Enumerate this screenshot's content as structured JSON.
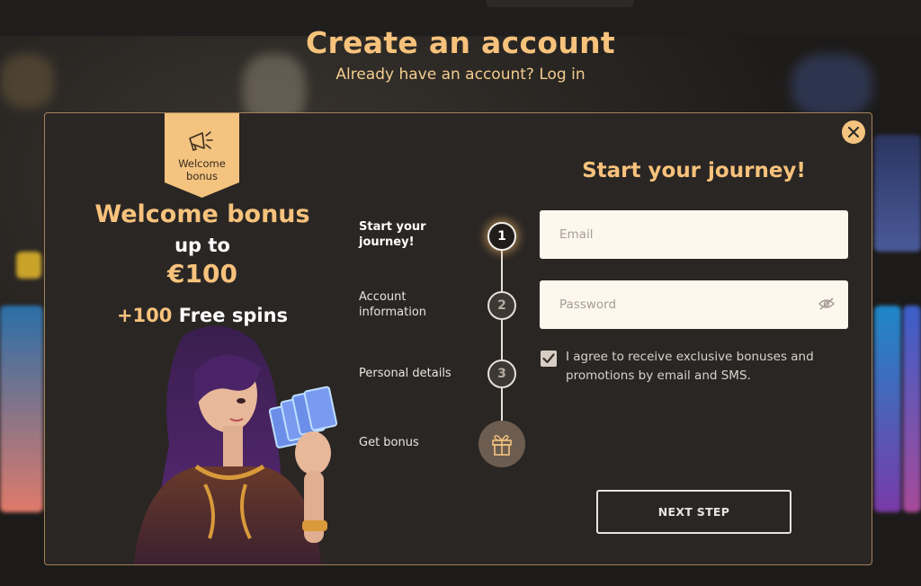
{
  "page": {
    "title": "Create an account",
    "login_prompt": "Already have an account?",
    "login_link": "Log in"
  },
  "promo": {
    "badge": "Welcome bonus",
    "badge_icon": "megaphone-icon",
    "title": "Welcome bonus",
    "upto": "up to",
    "amount": "€100",
    "spins_amount": "+100",
    "spins_label": "Free spins"
  },
  "steps": [
    {
      "label": "Start your journey!",
      "number": "1",
      "state": "active"
    },
    {
      "label": "Account information",
      "number": "2",
      "state": "inactive"
    },
    {
      "label": "Personal details",
      "number": "3",
      "state": "inactive"
    },
    {
      "label": "Get bonus",
      "icon": "gift-icon",
      "state": "inactive"
    }
  ],
  "form": {
    "title": "Start your journey!",
    "email_placeholder": "Email",
    "email_value": "",
    "password_placeholder": "Password",
    "password_value": "",
    "consent_checked": true,
    "consent_text": "I agree to receive exclusive bonuses and promotions by email and SMS.",
    "next_button": "NEXT STEP"
  },
  "colors": {
    "accent": "#f7c27c",
    "modal_bg": "#2a2624",
    "input_bg": "#fdf7ee",
    "modal_border": "#a6825a"
  }
}
